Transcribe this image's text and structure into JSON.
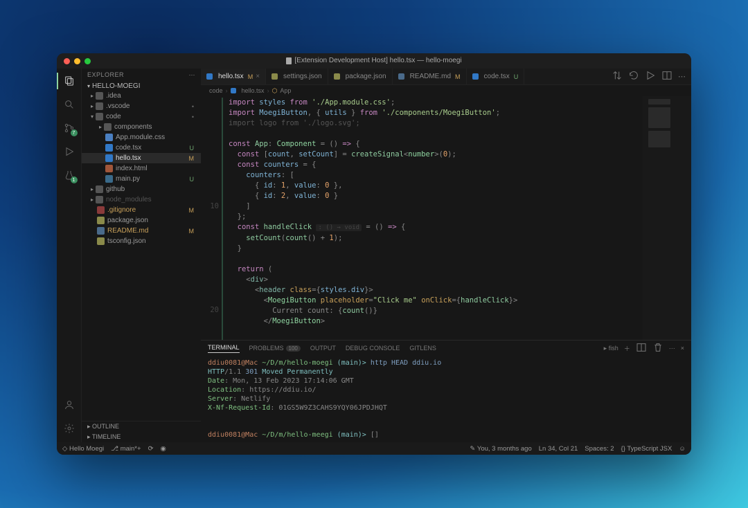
{
  "title": "[Extension Development Host] hello.tsx — hello-moegi",
  "explorer": {
    "title": "EXPLORER",
    "project": "HELLO-MOEGI"
  },
  "activity": {
    "scm_badge": "7",
    "test_badge": "1"
  },
  "tree": {
    "idea": ".idea",
    "vscode": ".vscode",
    "code": "code",
    "components": "components",
    "appmodule": "App.module.css",
    "codetsx": "code.tsx",
    "hellotsx": "hello.tsx",
    "indexhtml": "index.html",
    "mainpy": "main.py",
    "github": "github",
    "nodemodules": "node_modules",
    "gitignore": ".gitignore",
    "packagejson": "package.json",
    "readmemd": "README.md",
    "tsconfig": "tsconfig.json"
  },
  "status": {
    "M": "M",
    "U": "U",
    "dot": "•"
  },
  "outline": "OUTLINE",
  "timeline": "TIMELINE",
  "tabs": [
    {
      "label": "hello.tsx",
      "status": "M",
      "active": true,
      "close": true
    },
    {
      "label": "settings.json"
    },
    {
      "label": "package.json"
    },
    {
      "label": "README.md",
      "status": "M"
    },
    {
      "label": "code.tsx",
      "status": "U"
    }
  ],
  "breadcrumb": {
    "a": "code",
    "b": "hello.tsx",
    "c": "App"
  },
  "gutter_10": "10",
  "gutter_20": "20",
  "code": {
    "l1": {
      "a": "import",
      "b": "styles",
      "c": "from",
      "d": "'./App.module.css'",
      "e": ";"
    },
    "l2": {
      "a": "import",
      "b": "MoegiButton",
      "c": ", { ",
      "d": "utils",
      "e": " } ",
      "f": "from",
      "g": "'./components/MoegiButton'",
      "h": ";"
    },
    "l3": {
      "a": "import",
      "b": "logo",
      "c": "from",
      "d": "'./logo.svg'",
      "e": ";"
    },
    "l5": {
      "a": "const",
      "b": "App",
      "c": ": ",
      "d": "Component",
      "e": " = () ",
      "f": "=>",
      "g": " {"
    },
    "l6": {
      "a": "const",
      "b": "[",
      "c": "count",
      "d": ", ",
      "e": "setCount",
      "f": "] = ",
      "g": "createSignal",
      "h": "<",
      "i": "number",
      "j": ">(",
      "k": "0",
      "l": ");"
    },
    "l7": {
      "a": "const",
      "b": "counters",
      "c": " = {"
    },
    "l8": {
      "a": "counters",
      "b": ": ["
    },
    "l9": {
      "a": "{ ",
      "b": "id",
      "c": ": ",
      "d": "1",
      "e": ", ",
      "f": "value",
      "g": ": ",
      "h": "0",
      "i": " },"
    },
    "l10": {
      "a": "{ ",
      "b": "id",
      "c": ": ",
      "d": "2",
      "e": ", ",
      "f": "value",
      "g": ": ",
      "h": "0",
      "i": " }"
    },
    "l11": {
      "a": "]"
    },
    "l12": {
      "a": "};"
    },
    "l13": {
      "a": "const",
      "b": "handleClick",
      "ghost": ": () → void",
      "c": " = () ",
      "d": "=>",
      "e": " {"
    },
    "l14": {
      "a": "setCount",
      "b": "(",
      "c": "count",
      "d": "() + ",
      "e": "1",
      "f": ");"
    },
    "l15": {
      "a": "}"
    },
    "l17": {
      "a": "return",
      "b": " ("
    },
    "l18": {
      "a": "<",
      "b": "div",
      "c": ">"
    },
    "l19": {
      "a": "<",
      "b": "header",
      "c": " ",
      "d": "class",
      "e": "={",
      "f": "styles.div",
      "g": "}>"
    },
    "l20": {
      "a": "<",
      "b": "MoegiButton",
      "c": " ",
      "d": "placeholder",
      "e": "=",
      "f": "\"Click me\"",
      "g": " ",
      "h": "onClick",
      "i": "={",
      "j": "handleClick",
      "k": "}>"
    },
    "l21": {
      "a": "Current count: ",
      "b": "{",
      "c": "count",
      "d": "()}"
    },
    "l22": {
      "a": "</",
      "b": "MoegiButton",
      "c": ">"
    }
  },
  "panel": {
    "tabs": {
      "terminal": "TERMINAL",
      "problems": "PROBLEMS",
      "problems_count": "100",
      "output": "OUTPUT",
      "debug": "DEBUG CONSOLE",
      "gitlens": "GITLENS"
    },
    "shell": "fish"
  },
  "terminal": {
    "p1_user": "ddiu0081@Mac",
    "p1_path": "~/D/m/hello-moegi",
    "p1_branch": "(main)>",
    "p1_cmd": "http HEAD ddiu.io",
    "r1": "HTTP/1.1 301 Moved Permanently",
    "r1a": "HTTP",
    "r1b": "/1.1 ",
    "r1c": "301",
    "r1d": " Moved Permanently",
    "r2a": "Date",
    "r2b": ": Mon, 13 Feb 2023 17:14:06 GMT",
    "r3a": "Location",
    "r3b": ": https://ddiu.io/",
    "r4a": "Server",
    "r4b": ": Netlify",
    "r5a": "X-Nf-Request-Id",
    "r5b": ": 01GS5W9Z3CAHS9YQY06JPDJHQT",
    "p2_user": "ddiu0081@Mac",
    "p2_path": "~/D/m/hello-meegi",
    "p2_branch": "(main)>",
    "p2_cursor": "[]"
  },
  "statusbar": {
    "theme": "Hello Moegi",
    "branch": "main*+",
    "blame": "You, 3 months ago",
    "pos": "Ln 34, Col 21",
    "spaces": "Spaces: 2",
    "lang": "TypeScript JSX"
  }
}
